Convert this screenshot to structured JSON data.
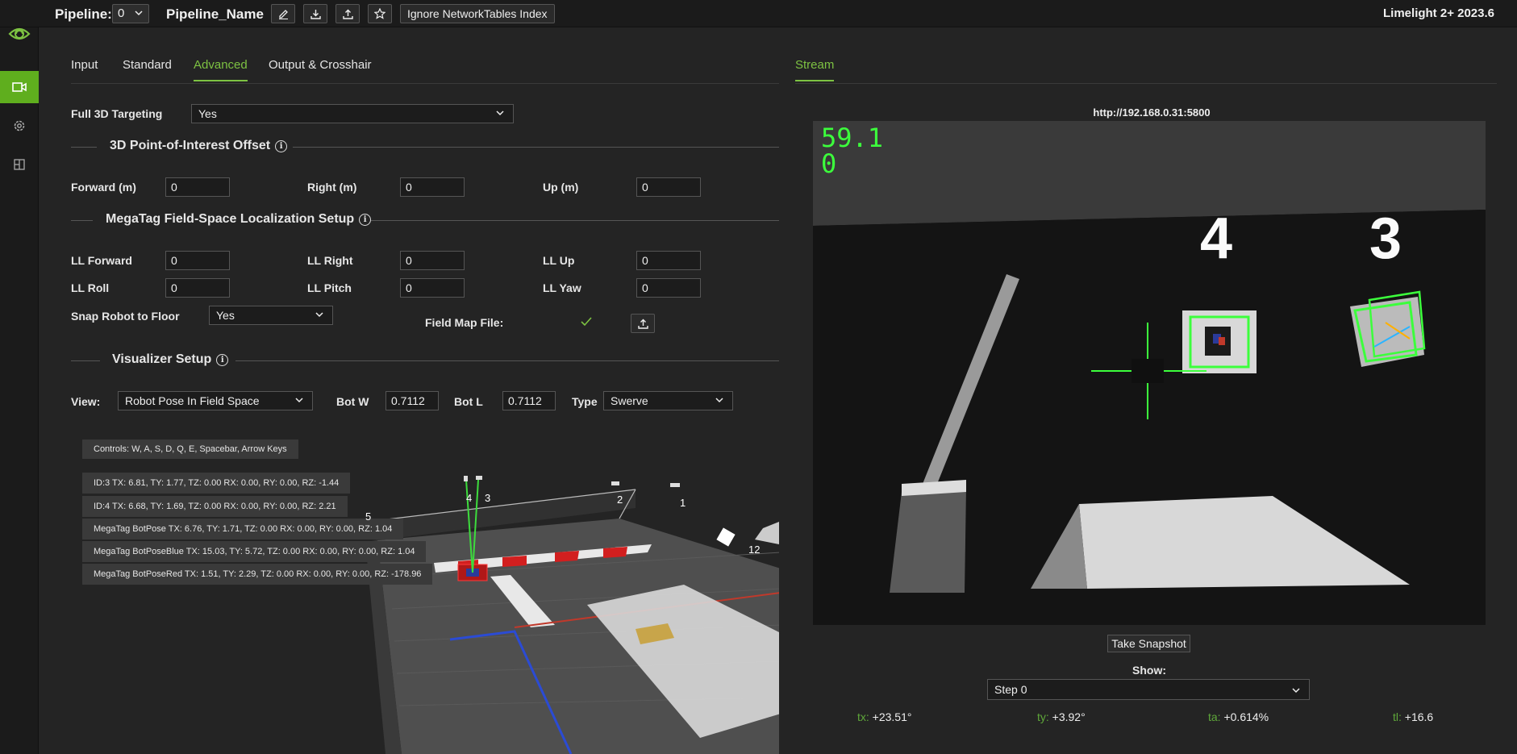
{
  "topbar": {
    "pipeline_label": "Pipeline:",
    "pipeline_index": "0",
    "pipeline_name": "Pipeline_Name",
    "ignore_nt_label": "Ignore NetworkTables Index",
    "version": "Limelight 2+ 2023.6"
  },
  "tabs": [
    "Input",
    "Standard",
    "Advanced",
    "Output & Crosshair"
  ],
  "active_tab": "Advanced",
  "full3d": {
    "label": "Full 3D Targeting",
    "value": "Yes"
  },
  "poi": {
    "title": "3D Point-of-Interest Offset",
    "forward_label": "Forward (m)",
    "forward": "0",
    "right_label": "Right (m)",
    "right": "0",
    "up_label": "Up (m)",
    "up": "0"
  },
  "megatag": {
    "title": "MegaTag Field-Space Localization Setup",
    "ll_forward_label": "LL Forward",
    "ll_forward": "0",
    "ll_right_label": "LL Right",
    "ll_right": "0",
    "ll_up_label": "LL Up",
    "ll_up": "0",
    "ll_roll_label": "LL Roll",
    "ll_roll": "0",
    "ll_pitch_label": "LL Pitch",
    "ll_pitch": "0",
    "ll_yaw_label": "LL Yaw",
    "ll_yaw": "0",
    "snap_label": "Snap Robot to Floor",
    "snap_value": "Yes",
    "field_map_label": "Field Map File:"
  },
  "visualizer": {
    "title": "Visualizer Setup",
    "view_label": "View:",
    "view_value": "Robot Pose In Field Space",
    "botw_label": "Bot W",
    "botw_value": "0.7112",
    "botl_label": "Bot L",
    "botl_value": "0.7112",
    "type_label": "Type",
    "type_value": "Swerve",
    "controls": "Controls: W, A, S, D, Q, E, Spacebar, Arrow Keys",
    "readouts": [
      "ID:3 TX: 6.81, TY: 1.77, TZ: 0.00 RX: 0.00, RY: 0.00, RZ: -1.44",
      "ID:4 TX: 6.68, TY: 1.69, TZ: 0.00 RX: 0.00, RY: 0.00, RZ: 2.21",
      "MegaTag BotPose TX: 6.76, TY: 1.71, TZ: 0.00 RX: 0.00, RY: 0.00, RZ: 1.04",
      "MegaTag BotPoseBlue TX: 15.03, TY: 5.72, TZ: 0.00 RX: 0.00, RY: 0.00, RZ: 1.04",
      "MegaTag BotPoseRed TX: 1.51, TY: 2.29, TZ: 0.00 RX: 0.00, RY: 0.00, RZ: -178.96"
    ],
    "tag_labels": [
      "5",
      "4",
      "3",
      "2",
      "1",
      "12"
    ]
  },
  "stream": {
    "tab": "Stream",
    "url": "http://192.168.0.31:5800",
    "fps": "59.1",
    "fps2": "0",
    "tag_a": "4",
    "tag_b": "3",
    "snapshot": "Take Snapshot",
    "show_label": "Show:",
    "show_value": "Step 0",
    "tx_label": "tx:",
    "tx": "+23.51°",
    "ty_label": "ty:",
    "ty": "+3.92°",
    "ta_label": "ta:",
    "ta": "+0.614%",
    "tl_label": "tl:",
    "tl": "+16.6"
  },
  "colors": {
    "accent": "#7dc242",
    "sidebar_active": "#5fae1e",
    "target_box": "#3cff3c"
  }
}
